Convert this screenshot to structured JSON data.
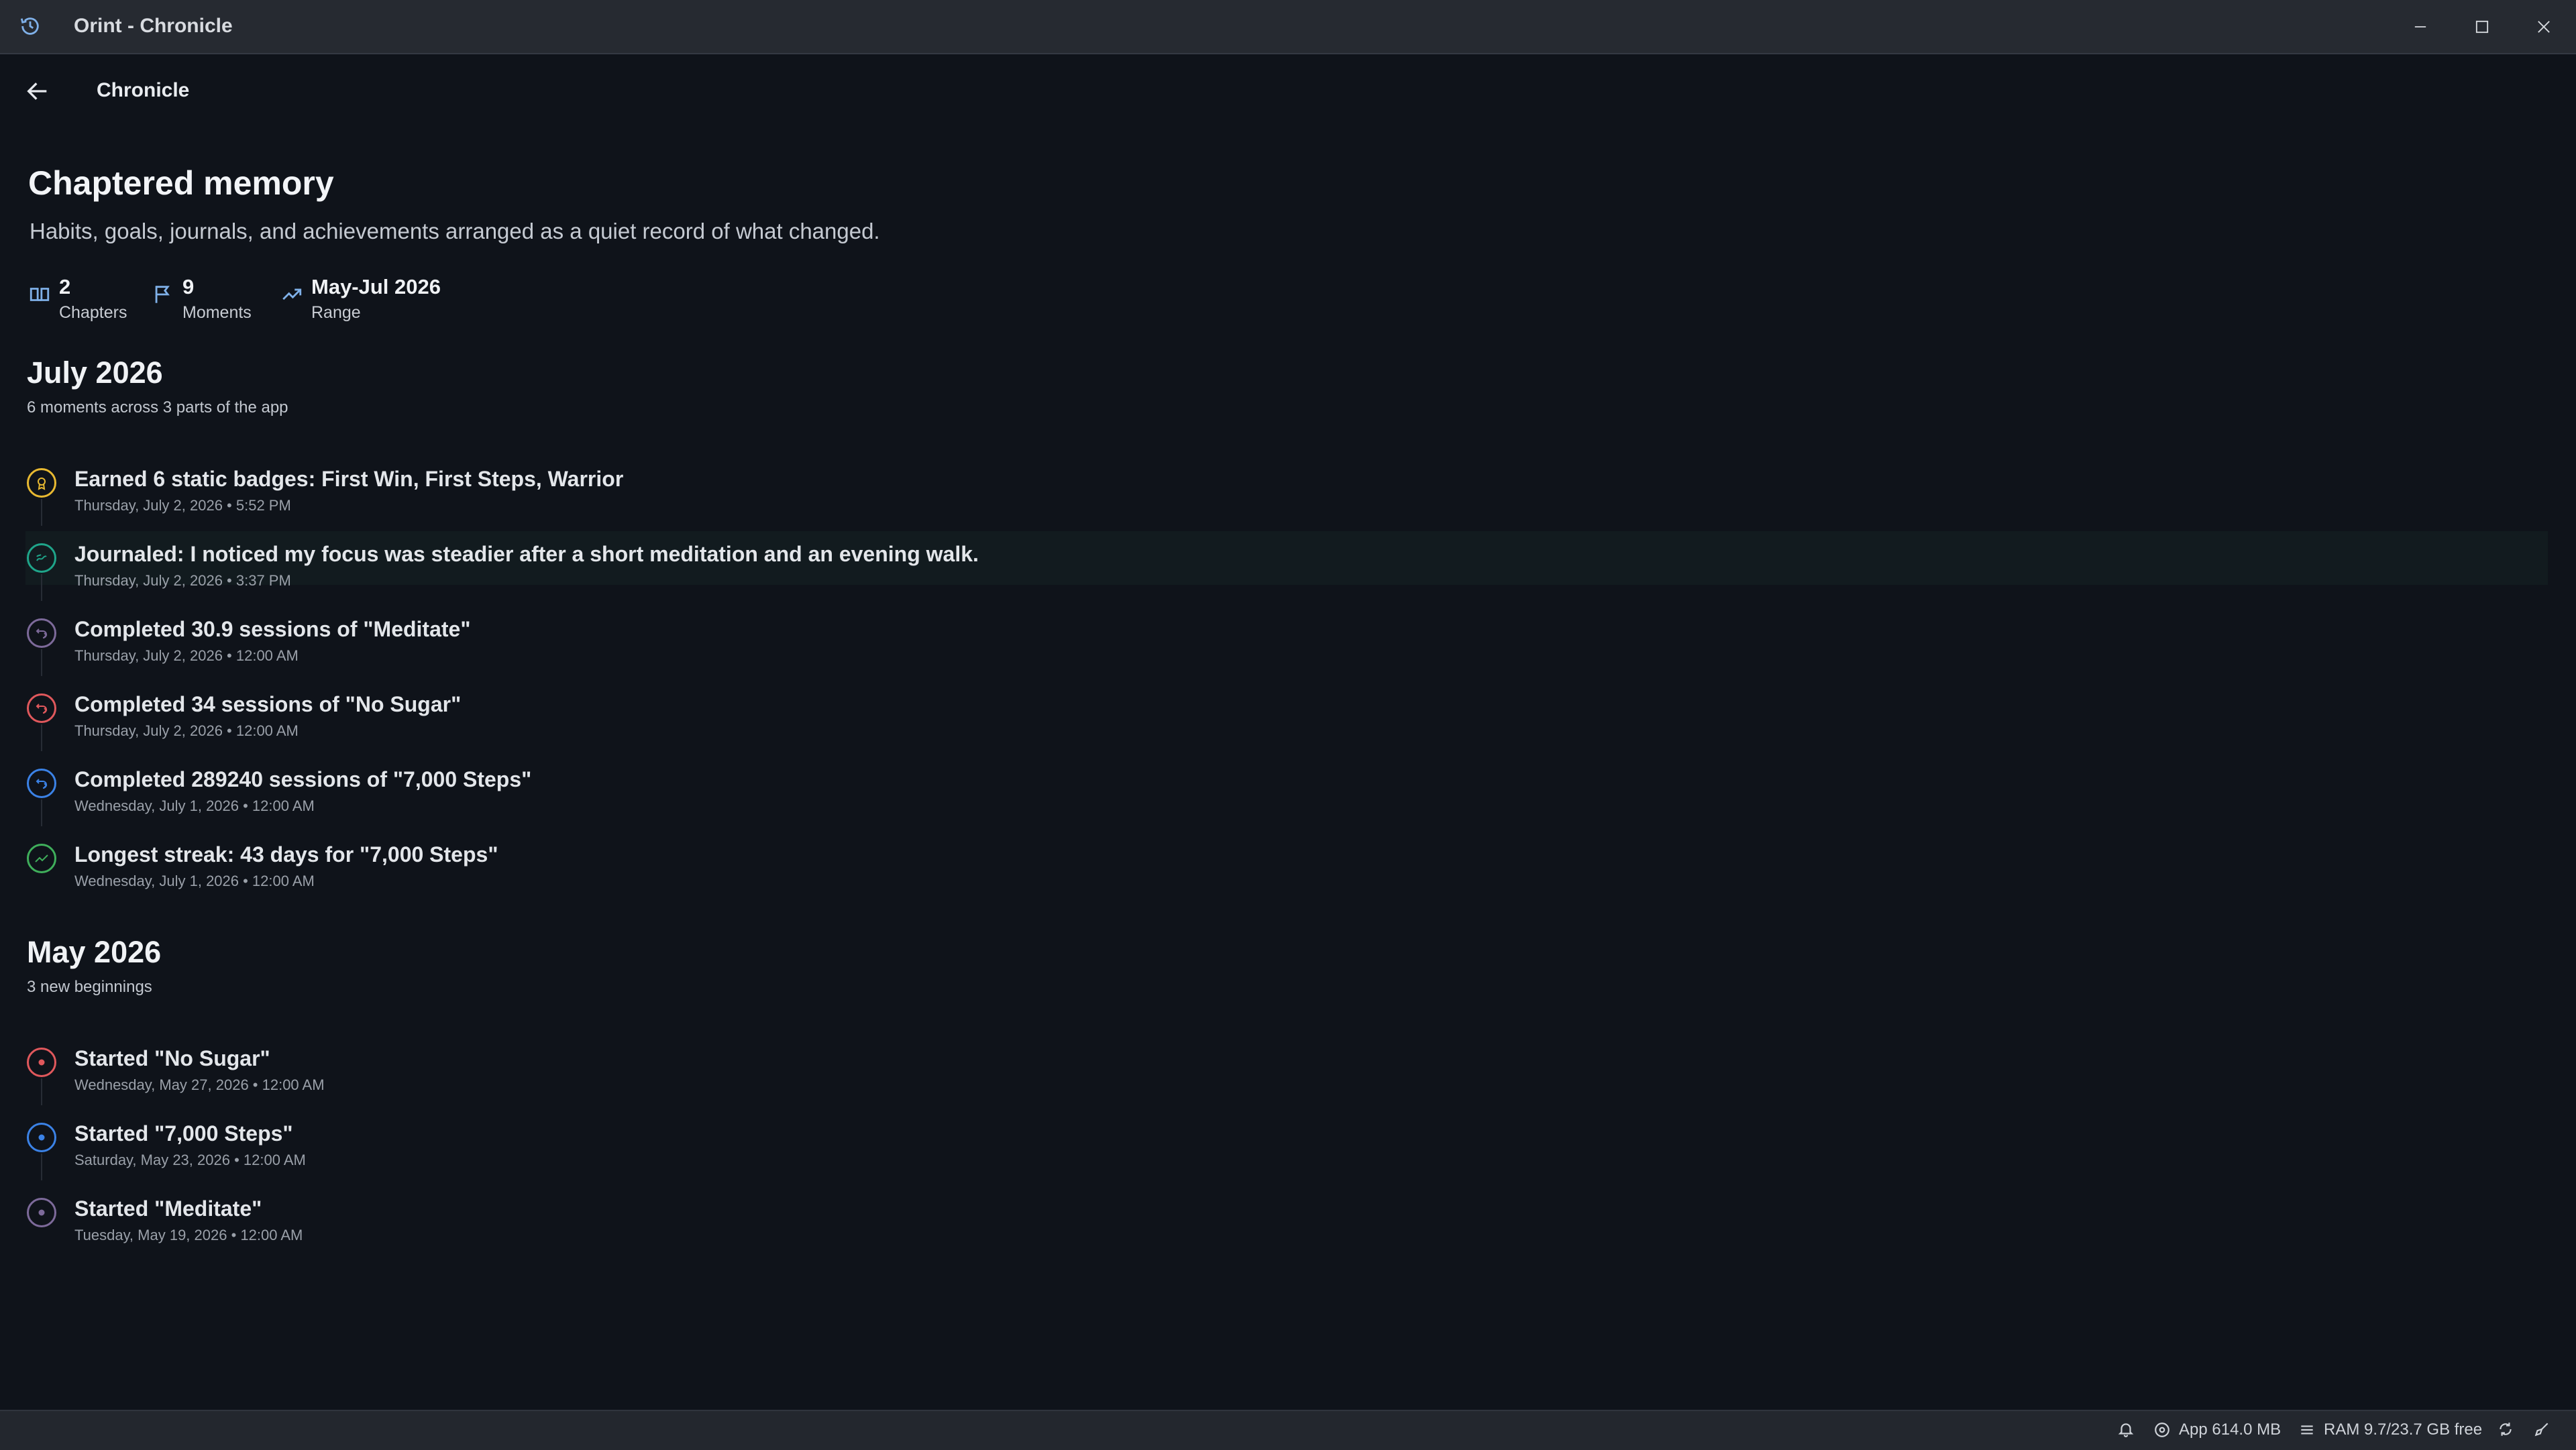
{
  "window": {
    "title": "Orint - Chronicle"
  },
  "nav": {
    "crumb": "Chronicle"
  },
  "header": {
    "title": "Chaptered memory",
    "subtitle": "Habits, goals, journals, and achievements arranged as a quiet record of what changed."
  },
  "stats": [
    {
      "value": "2",
      "label": "Chapters",
      "icon": "book-icon"
    },
    {
      "value": "9",
      "label": "Moments",
      "icon": "flag-icon"
    },
    {
      "value": "May-Jul 2026",
      "label": "Range",
      "icon": "trend-icon"
    }
  ],
  "chapters": [
    {
      "title": "July 2026",
      "subtitle": "6 moments across 3 parts of the app",
      "items": [
        {
          "title": "Earned 6 static badges: First Win, First Steps, Warrior",
          "date": "Thursday, July 2, 2026 • 5:52 PM",
          "color": "#e8b931",
          "icon": "badge-icon"
        },
        {
          "title": "Journaled: I noticed my focus was steadier after a short meditation and an evening walk.",
          "date": "Thursday, July 2, 2026 • 3:37 PM",
          "color": "#1fa58a",
          "icon": "journal-icon",
          "highlighted": true
        },
        {
          "title": "Completed 30.9 sessions of \"Meditate\"",
          "date": "Thursday, July 2, 2026 • 12:00 AM",
          "color": "#7d6a9a",
          "icon": "repeat-icon"
        },
        {
          "title": "Completed 34 sessions of \"No Sugar\"",
          "date": "Thursday, July 2, 2026 • 12:00 AM",
          "color": "#e0585c",
          "icon": "repeat-icon"
        },
        {
          "title": "Completed 289240 sessions of \"7,000 Steps\"",
          "date": "Wednesday, July 1, 2026 • 12:00 AM",
          "color": "#3b82e6",
          "icon": "repeat-icon"
        },
        {
          "title": "Longest streak: 43 days for \"7,000 Steps\"",
          "date": "Wednesday, July 1, 2026 • 12:00 AM",
          "color": "#3fae5b",
          "icon": "trend-icon"
        }
      ]
    },
    {
      "title": "May 2026",
      "subtitle": "3 new beginnings",
      "items": [
        {
          "title": "Started \"No Sugar\"",
          "date": "Wednesday, May 27, 2026 • 12:00 AM",
          "color": "#e0585c",
          "icon": "start-icon"
        },
        {
          "title": "Started \"7,000 Steps\"",
          "date": "Saturday, May 23, 2026 • 12:00 AM",
          "color": "#3b82e6",
          "icon": "start-icon"
        },
        {
          "title": "Started \"Meditate\"",
          "date": "Tuesday, May 19, 2026 • 12:00 AM",
          "color": "#7d6a9a",
          "icon": "start-icon"
        }
      ]
    }
  ],
  "statusbar": {
    "app_memory": "App 614.0 MB",
    "ram": "RAM 9.7/23.7 GB free"
  }
}
